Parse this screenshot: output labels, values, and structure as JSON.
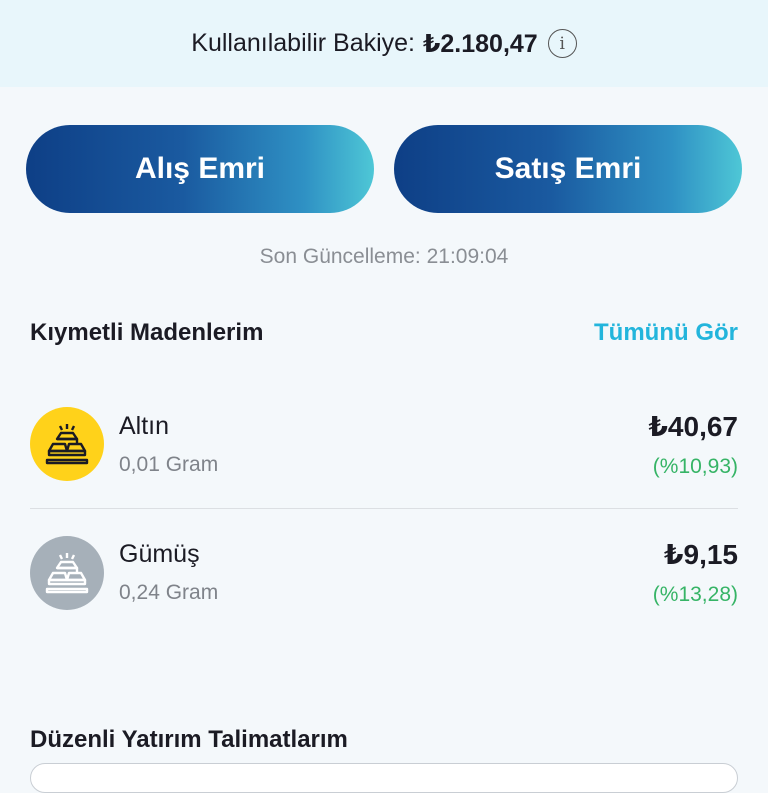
{
  "balance": {
    "label": "Kullanılabilir Bakiye:",
    "amount": "₺2.180,47",
    "info_icon": "info-circle-icon"
  },
  "actions": {
    "buy_label": "Alış Emri",
    "sell_label": "Satış Emri"
  },
  "last_update": "Son Güncelleme: 21:09:04",
  "metals": {
    "title": "Kıymetli Madenlerim",
    "see_all": "Tümünü Gör",
    "items": [
      {
        "name": "Altın",
        "quantity": "0,01 Gram",
        "price": "₺40,67",
        "change": "(%10,93)",
        "icon": "gold-bars-icon",
        "icon_bg": "#ffd21a"
      },
      {
        "name": "Gümüş",
        "quantity": "0,24 Gram",
        "price": "₺9,15",
        "change": "(%13,28)",
        "icon": "silver-bars-icon",
        "icon_bg": "#a6b0b9"
      }
    ]
  },
  "instructions": {
    "title": "Düzenli Yatırım Talimatlarım"
  },
  "colors": {
    "accent": "#23b5dc",
    "positive": "#36b466",
    "button_gradient_start": "#0e3f86",
    "button_gradient_end": "#4ec7d6"
  }
}
